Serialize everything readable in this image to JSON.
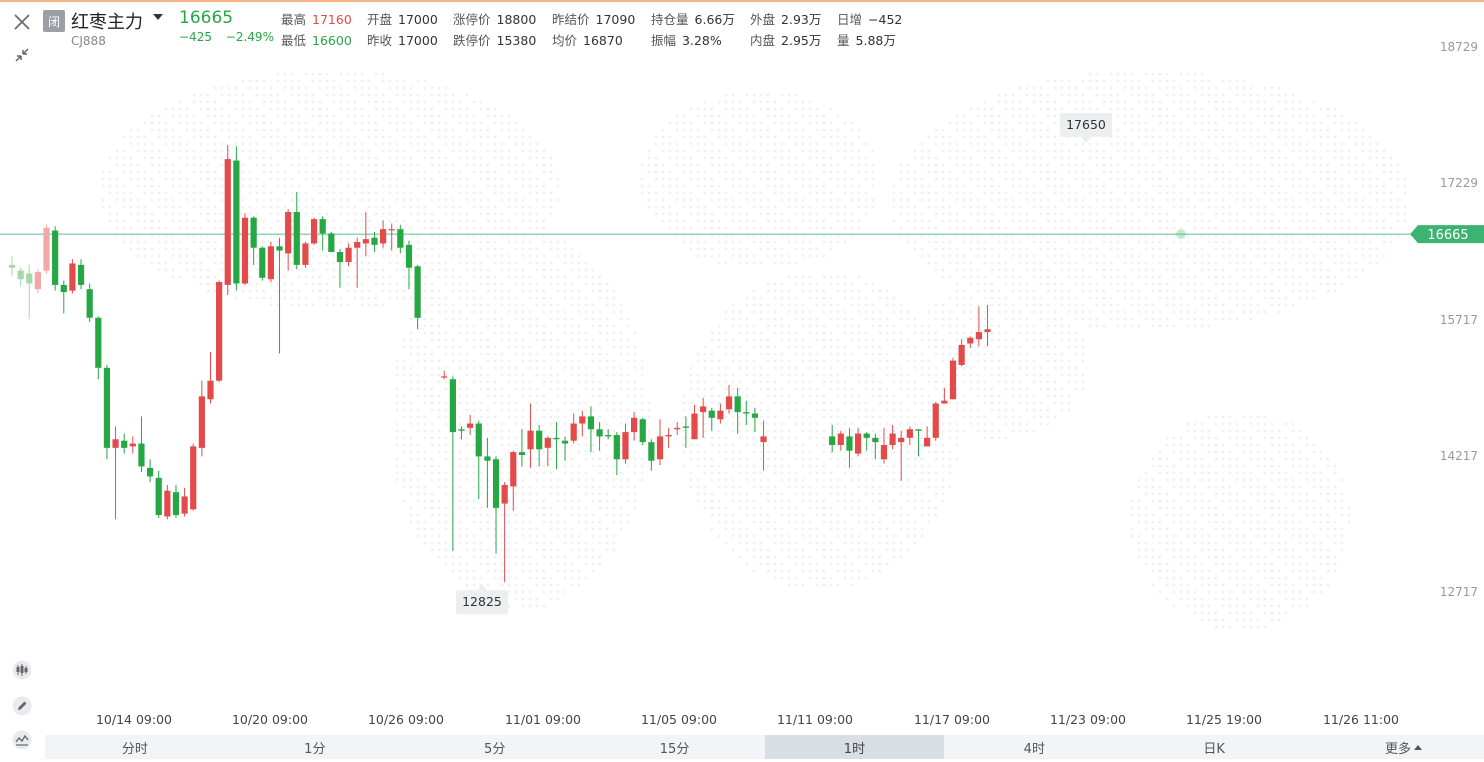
{
  "header": {
    "status": "闭",
    "name": "红枣主力",
    "code": "CJ888",
    "price": "16665",
    "change": "−425",
    "change_pct": "−2.49%"
  },
  "stats": {
    "row1": [
      {
        "key": "最高",
        "value": "17160",
        "tone": "red"
      },
      {
        "key": "开盘",
        "value": "17000",
        "tone": ""
      },
      {
        "key": "涨停价",
        "value": "18800",
        "tone": ""
      },
      {
        "key": "昨结价",
        "value": "17090",
        "tone": ""
      },
      {
        "key": "持仓量",
        "value": "6.66万",
        "tone": ""
      },
      {
        "key": "外盘",
        "value": "2.93万",
        "tone": ""
      },
      {
        "key": "日增",
        "value": "−452",
        "tone": ""
      }
    ],
    "row2": [
      {
        "key": "最低",
        "value": "16600",
        "tone": "green"
      },
      {
        "key": "昨收",
        "value": "17000",
        "tone": ""
      },
      {
        "key": "跌停价",
        "value": "15380",
        "tone": ""
      },
      {
        "key": "均价",
        "value": "16870",
        "tone": ""
      },
      {
        "key": "振幅",
        "value": "3.28%",
        "tone": ""
      },
      {
        "key": "内盘",
        "value": "2.95万",
        "tone": ""
      },
      {
        "key": "量",
        "value": "5.88万",
        "tone": ""
      }
    ]
  },
  "sidebar": {
    "close_icon": "close-icon",
    "collapse_icon": "shrink-icon",
    "tools": [
      "candlestick-icon",
      "pencil-icon",
      "indicator-icon"
    ]
  },
  "colors": {
    "up": "#e34b4b",
    "down": "#27a644",
    "last_price_line": "#3cb371",
    "faded_up": "#f0a8a8",
    "faded_down": "#a3d9a8"
  },
  "chart_data": {
    "type": "candlestick",
    "y_ticks": [
      "18729",
      "17229",
      "15717",
      "14217",
      "12717"
    ],
    "y_tick_values": [
      18729,
      17229,
      15717,
      14217,
      12717
    ],
    "x_ticks": [
      "10/14 09:00",
      "10/20 09:00",
      "10/26 09:00",
      "11/01 09:00",
      "11/05 09:00",
      "11/11 09:00",
      "11/17 09:00",
      "11/23 09:00",
      "11/25 19:00",
      "11/26 11:00"
    ],
    "last_price": "16665",
    "max_label": "17650",
    "min_label": "12825",
    "candles": [
      [
        15500,
        15480,
        15560,
        15420
      ],
      [
        15460,
        15400,
        15480,
        15350
      ],
      [
        15440,
        15370,
        15500,
        15120
      ],
      [
        15330,
        15450,
        15470,
        15300
      ],
      [
        15460,
        15760,
        15780,
        15440
      ],
      [
        15740,
        15360,
        15770,
        15320
      ],
      [
        15360,
        15310,
        15390,
        15160
      ],
      [
        15320,
        15510,
        15540,
        15300
      ],
      [
        15500,
        15360,
        15540,
        15330
      ],
      [
        15330,
        15130,
        15370,
        15100
      ],
      [
        15130,
        14780,
        15140,
        14700
      ],
      [
        14780,
        14220,
        14800,
        14140
      ],
      [
        14220,
        14280,
        14370,
        13720
      ],
      [
        14270,
        14220,
        14320,
        14180
      ],
      [
        14230,
        14250,
        14300,
        14180
      ],
      [
        14250,
        14090,
        14440,
        14050
      ],
      [
        14080,
        14020,
        14140,
        13980
      ],
      [
        14010,
        13750,
        14060,
        13730
      ],
      [
        13740,
        13920,
        13960,
        13720
      ],
      [
        13910,
        13750,
        13960,
        13730
      ],
      [
        13760,
        13880,
        13940,
        13740
      ],
      [
        13790,
        14230,
        14250,
        13780
      ],
      [
        14220,
        14580,
        14690,
        14160
      ],
      [
        14560,
        14690,
        14890,
        14530
      ],
      [
        14690,
        15380,
        15390,
        14680
      ],
      [
        15360,
        16240,
        16340,
        15290
      ],
      [
        16230,
        15370,
        16330,
        15320
      ],
      [
        15370,
        15830,
        15860,
        15360
      ],
      [
        15830,
        15620,
        15840,
        15500
      ],
      [
        15620,
        15410,
        15630,
        15390
      ],
      [
        15400,
        15630,
        15660,
        15380
      ],
      [
        15630,
        15600,
        15690,
        14880
      ],
      [
        15580,
        15870,
        15890,
        15460
      ],
      [
        15870,
        15500,
        16010,
        15470
      ],
      [
        15500,
        15650,
        15660,
        15480
      ],
      [
        15650,
        15820,
        15830,
        15640
      ],
      [
        15820,
        15720,
        15840,
        15600
      ],
      [
        15720,
        15590,
        15730,
        15590
      ],
      [
        15590,
        15520,
        15610,
        15340
      ],
      [
        15520,
        15620,
        15650,
        15490
      ],
      [
        15620,
        15660,
        15690,
        15340
      ],
      [
        15650,
        15680,
        15870,
        15560
      ],
      [
        15690,
        15640,
        15730,
        15590
      ],
      [
        15650,
        15750,
        15810,
        15620
      ],
      [
        15750,
        15750,
        15790,
        15600
      ],
      [
        15750,
        15620,
        15780,
        15580
      ],
      [
        15640,
        15480,
        15670,
        15330
      ],
      [
        15490,
        15130,
        15500,
        15050
      ],
      [
        14720,
        14720,
        14760,
        14700
      ],
      [
        14700,
        14330,
        14720,
        13500
      ],
      [
        14350,
        14340,
        14370,
        14280
      ],
      [
        14360,
        14390,
        14450,
        14310
      ],
      [
        14390,
        14160,
        14410,
        13860
      ],
      [
        14160,
        14130,
        14290,
        13800
      ],
      [
        14140,
        13800,
        14160,
        13480
      ],
      [
        13830,
        13960,
        13980,
        13280
      ],
      [
        13950,
        14190,
        14200,
        13780
      ],
      [
        14190,
        14170,
        14350,
        14090
      ],
      [
        14210,
        14340,
        14530,
        14080
      ],
      [
        14340,
        14210,
        14380,
        14090
      ],
      [
        14220,
        14290,
        14300,
        14090
      ],
      [
        14290,
        14280,
        14400,
        14070
      ],
      [
        14270,
        14250,
        14300,
        14130
      ],
      [
        14270,
        14390,
        14460,
        14250
      ],
      [
        14390,
        14440,
        14480,
        14300
      ],
      [
        14440,
        14350,
        14510,
        14190
      ],
      [
        14350,
        14300,
        14400,
        14200
      ],
      [
        14310,
        14300,
        14350,
        14280
      ],
      [
        14310,
        14140,
        14330,
        14030
      ],
      [
        14140,
        14330,
        14390,
        14110
      ],
      [
        14330,
        14430,
        14470,
        14270
      ],
      [
        14420,
        14260,
        14430,
        14240
      ],
      [
        14260,
        14130,
        14280,
        14060
      ],
      [
        14140,
        14300,
        14420,
        14100
      ],
      [
        14300,
        14310,
        14360,
        14220
      ],
      [
        14350,
        14360,
        14400,
        14310
      ],
      [
        14370,
        14360,
        14440,
        14220
      ],
      [
        14280,
        14460,
        14520,
        14290
      ],
      [
        14470,
        14510,
        14570,
        14290
      ],
      [
        14480,
        14430,
        14500,
        14340
      ],
      [
        14420,
        14480,
        14530,
        14390
      ],
      [
        14490,
        14580,
        14660,
        14460
      ],
      [
        14580,
        14470,
        14640,
        14320
      ],
      [
        14470,
        14460,
        14550,
        14380
      ],
      [
        14460,
        14430,
        14500,
        14330
      ],
      [
        14260,
        14300,
        14410,
        14060
      ],
      [
        14300,
        14240,
        14380,
        14190
      ],
      [
        14240,
        14320,
        14340,
        14200
      ],
      [
        14300,
        14200,
        14360,
        14080
      ],
      [
        14180,
        14320,
        14360,
        14160
      ],
      [
        14320,
        14290,
        14330,
        14200
      ],
      [
        14290,
        14260,
        14320,
        14140
      ],
      [
        14140,
        14240,
        14360,
        14110
      ],
      [
        14240,
        14320,
        14380,
        14210
      ],
      [
        14260,
        14290,
        14340,
        13990
      ],
      [
        14290,
        14350,
        14370,
        14240
      ],
      [
        14350,
        14340,
        14350,
        14160
      ],
      [
        14230,
        14290,
        14370,
        14230
      ],
      [
        14290,
        14530,
        14540,
        14270
      ],
      [
        14530,
        14550,
        14640,
        14530
      ],
      [
        14560,
        14830,
        14850,
        14560
      ],
      [
        14800,
        14940,
        14980,
        14790
      ],
      [
        14950,
        14990,
        15000,
        14920
      ],
      [
        14980,
        15030,
        15210,
        14930
      ],
      [
        15030,
        15050,
        15220,
        14930
      ]
    ]
  },
  "tabs": {
    "items": [
      "分时",
      "1分",
      "5分",
      "15分",
      "1时",
      "4时",
      "日K"
    ],
    "active_index": 4,
    "more": "更多"
  }
}
